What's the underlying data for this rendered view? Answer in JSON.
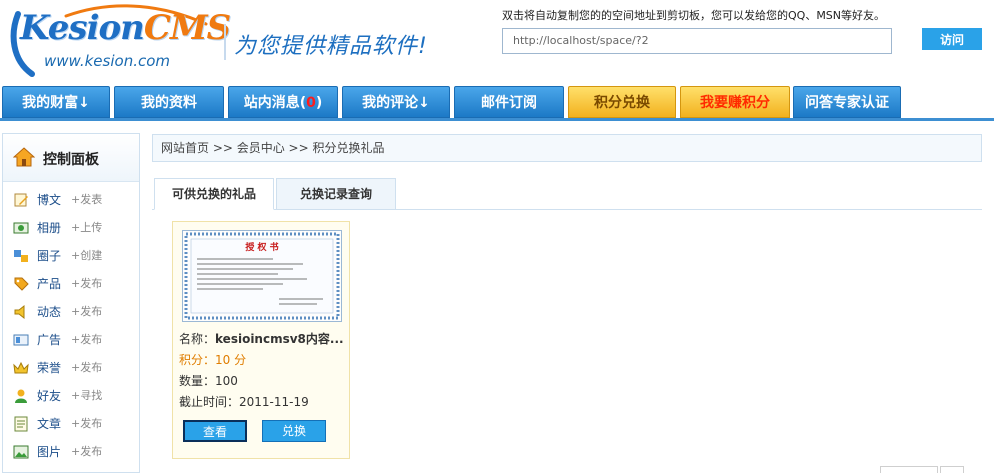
{
  "header": {
    "logo_brand": "Kesion",
    "logo_brand_suffix": "CMS",
    "logo_url": "www.kesion.com",
    "slogan": "为您提供精品软件!",
    "copy_tip": "双击将自动复制您的的空间地址到剪切板，您可以发给您的QQ、MSN等好友。",
    "space_url": "http://localhost/space/?2",
    "visit_label": "访问"
  },
  "nav": {
    "items": [
      {
        "label": "我的财富↓"
      },
      {
        "label": "我的资料"
      },
      {
        "label": "站内消息(",
        "badge": "0",
        "suffix": ")"
      },
      {
        "label": "我的评论↓"
      },
      {
        "label": "邮件订阅"
      },
      {
        "label": "积分兑换"
      },
      {
        "label": "我要赚积分"
      },
      {
        "label": "问答专家认证"
      }
    ]
  },
  "sidebar": {
    "title": "控制面板",
    "items": [
      {
        "name": "博文",
        "action": "+发表",
        "icon": "pencil-note-icon"
      },
      {
        "name": "相册",
        "action": "+上传",
        "icon": "photo-icon"
      },
      {
        "name": "圈子",
        "action": "+创建",
        "icon": "group-icon"
      },
      {
        "name": "产品",
        "action": "+发布",
        "icon": "tag-icon"
      },
      {
        "name": "动态",
        "action": "+发布",
        "icon": "speaker-icon"
      },
      {
        "name": "广告",
        "action": "+发布",
        "icon": "ad-card-icon"
      },
      {
        "name": "荣誉",
        "action": "+发布",
        "icon": "crown-icon"
      },
      {
        "name": "好友",
        "action": "+寻找",
        "icon": "user-icon"
      },
      {
        "name": "文章",
        "action": "+发布",
        "icon": "document-icon"
      },
      {
        "name": "图片",
        "action": "+发布",
        "icon": "picture-icon"
      }
    ]
  },
  "breadcrumb": "网站首页 >> 会员中心 >> 积分兑换礼品",
  "tabs": [
    {
      "label": "可供兑换的礼品"
    },
    {
      "label": "兑换记录查询"
    }
  ],
  "gift": {
    "certificate_title": "授 权 书",
    "name_label": "名称：",
    "name_value": "kesioincmsv8内容...",
    "points": "积分：10 分",
    "quantity": "数量：100",
    "deadline": "截止时间：2011-11-19",
    "view_label": "查看",
    "redeem_label": "兑换"
  },
  "colors": {
    "nav_blue": "#1c79c6",
    "nav_gold": "#f2b11e",
    "hot_red": "#ff2a00",
    "button_blue": "#2aa2e8",
    "points_orange": "#e07d00"
  }
}
